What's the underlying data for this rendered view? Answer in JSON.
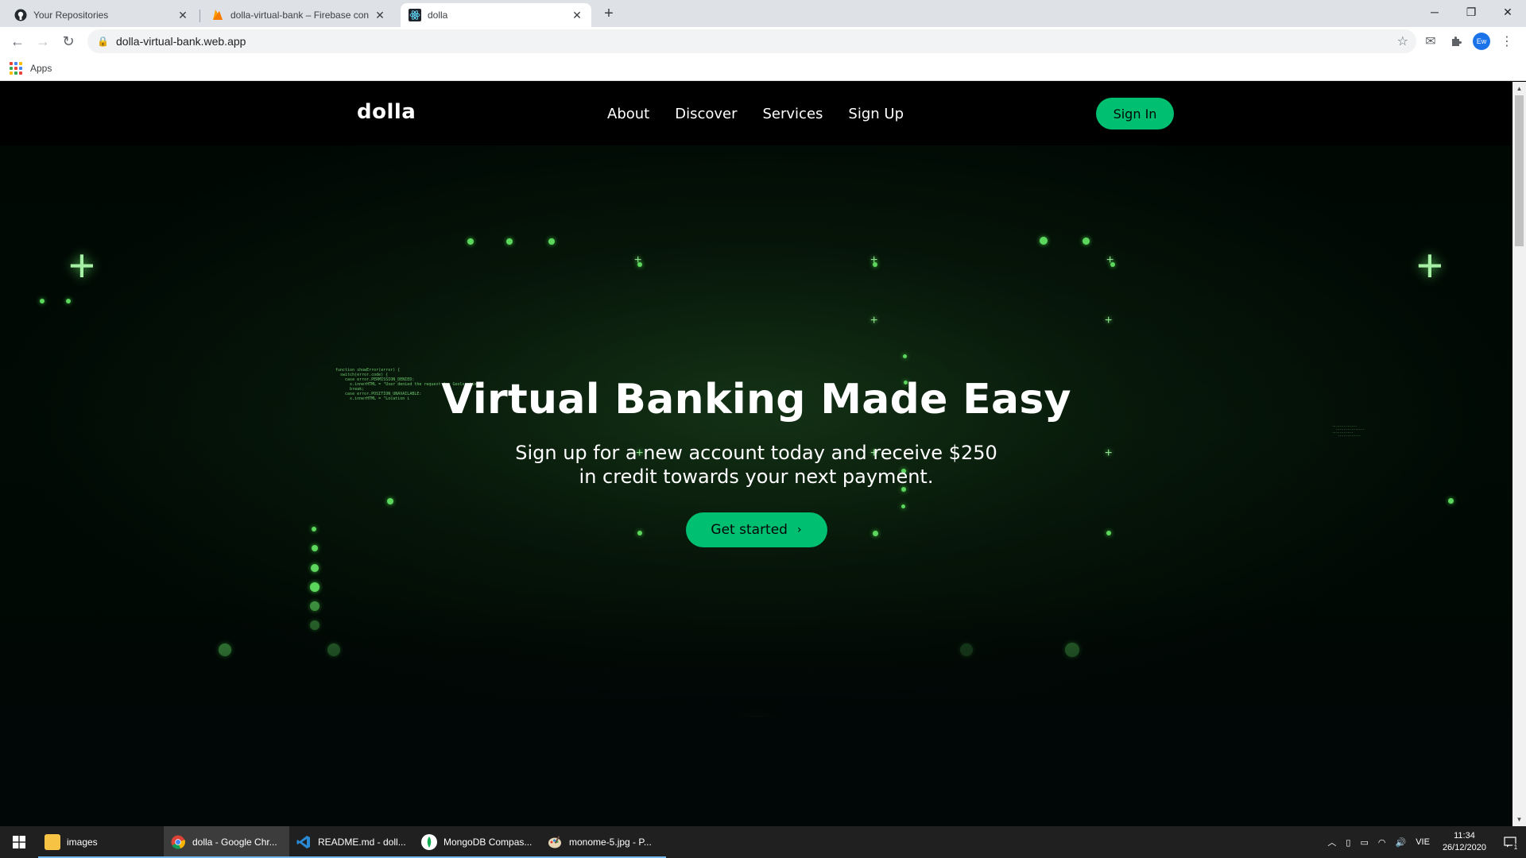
{
  "browser": {
    "tabs": [
      {
        "title": "Your Repositories",
        "icon": "github-icon"
      },
      {
        "title": "dolla-virtual-bank – Firebase con",
        "icon": "firebase-icon"
      },
      {
        "title": "dolla",
        "icon": "react-icon",
        "active": true
      }
    ],
    "new_tab": "+",
    "url": "dolla-virtual-bank.web.app",
    "bookmarks": {
      "apps_label": "Apps"
    },
    "profile_initials": "Ew"
  },
  "site": {
    "logo": "dolla",
    "nav": [
      "About",
      "Discover",
      "Services",
      "Sign Up"
    ],
    "signin_label": "Sign In",
    "hero": {
      "title": "Virtual Banking Made Easy",
      "subtitle": "Sign up for a new account today and receive $250 in credit towards your next payment.",
      "cta_label": "Get started"
    },
    "accent_color": "#01bf71"
  },
  "taskbar": {
    "items": [
      {
        "label": "images",
        "icon": "folder-icon"
      },
      {
        "label": "dolla - Google Chr...",
        "icon": "chrome-icon",
        "active": true
      },
      {
        "label": "README.md - doll...",
        "icon": "vscode-icon"
      },
      {
        "label": "MongoDB Compas...",
        "icon": "mongodb-icon"
      },
      {
        "label": "monome-5.jpg - P...",
        "icon": "paint-icon"
      }
    ],
    "language": "VIE",
    "time": "11:34",
    "date": "26/12/2020",
    "notification_count": "1"
  }
}
